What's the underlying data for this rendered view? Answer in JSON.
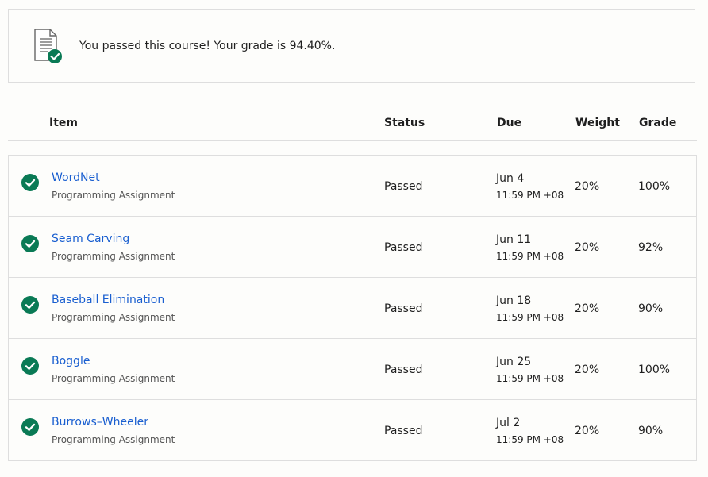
{
  "banner": {
    "message": "You passed this course! Your grade is 94.40%.",
    "icon": "document-check-icon"
  },
  "table": {
    "headers": {
      "item": "Item",
      "status": "Status",
      "due": "Due",
      "weight": "Weight",
      "grade": "Grade"
    },
    "rows": [
      {
        "title": "WordNet",
        "type": "Programming Assignment",
        "status": "Passed",
        "due_date": "Jun 4",
        "due_time": "11:59 PM +08",
        "weight": "20%",
        "grade": "100%"
      },
      {
        "title": "Seam Carving",
        "type": "Programming Assignment",
        "status": "Passed",
        "due_date": "Jun 11",
        "due_time": "11:59 PM +08",
        "weight": "20%",
        "grade": "92%"
      },
      {
        "title": "Baseball Elimination",
        "type": "Programming Assignment",
        "status": "Passed",
        "due_date": "Jun 18",
        "due_time": "11:59 PM +08",
        "weight": "20%",
        "grade": "90%"
      },
      {
        "title": "Boggle",
        "type": "Programming Assignment",
        "status": "Passed",
        "due_date": "Jun 25",
        "due_time": "11:59 PM +08",
        "weight": "20%",
        "grade": "100%"
      },
      {
        "title": "Burrows–Wheeler",
        "type": "Programming Assignment",
        "status": "Passed",
        "due_date": "Jul 2",
        "due_time": "11:59 PM +08",
        "weight": "20%",
        "grade": "90%"
      }
    ]
  },
  "colors": {
    "accent_green": "#0a7a55",
    "link_blue": "#1a5fd0",
    "border": "#dedede"
  }
}
